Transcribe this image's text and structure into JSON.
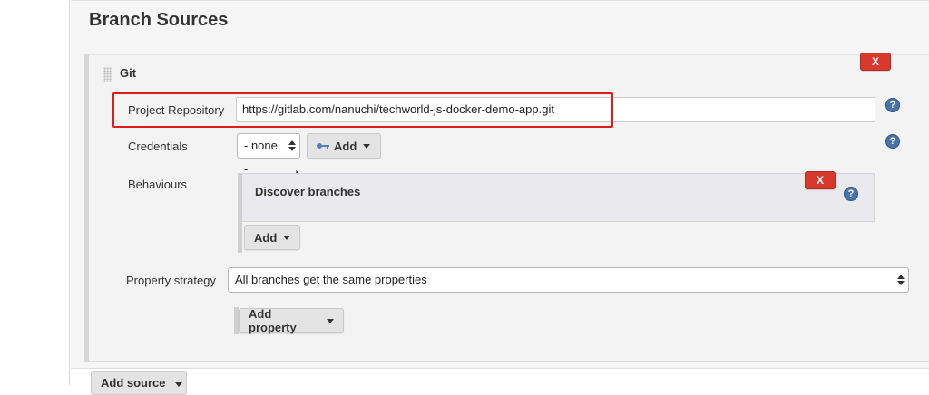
{
  "section": {
    "title": "Branch Sources"
  },
  "git": {
    "title": "Git",
    "delete_label": "X",
    "project_repository": {
      "label": "Project Repository",
      "value": "https://gitlab.com/nanuchi/techworld-js-docker-demo-app.git"
    },
    "credentials": {
      "label": "Credentials",
      "selected": "- none -",
      "add_label": "Add"
    },
    "behaviours": {
      "label": "Behaviours",
      "items": [
        {
          "title": "Discover branches",
          "delete_label": "X"
        }
      ],
      "add_label": "Add"
    },
    "property_strategy": {
      "label": "Property strategy",
      "selected": "All branches get the same properties",
      "add_property_label": "Add property"
    }
  },
  "footer": {
    "add_source_label": "Add source"
  },
  "icons": {
    "help": "?"
  },
  "colors": {
    "danger": "#d9382c",
    "highlight": "#e01b1b",
    "help_blue": "#4a73a8"
  }
}
